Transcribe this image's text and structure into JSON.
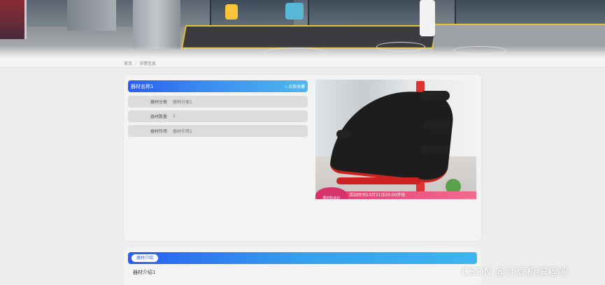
{
  "breadcrumb": {
    "home": "首页",
    "separator": "/",
    "current": "详情信息"
  },
  "equipment": {
    "name": "器材名称1",
    "like_label": "点我收藏",
    "fields": [
      {
        "label": "器材分类",
        "value": "器材分类1"
      },
      {
        "label": "器材数量",
        "value": "1"
      },
      {
        "label": "器材作用",
        "value": "器材作用1"
      }
    ],
    "photo_promo": "活动时间10月31日20:00开抢",
    "photo_badge": "限时秒杀价"
  },
  "intro": {
    "tab_label": "器材介绍",
    "content": "器材介绍1"
  },
  "watermark": "CSDN @计算机编程吧",
  "colors": {
    "accent_start": "#2b5ef0",
    "accent_end": "#4fb8ee",
    "background": "#ededed"
  }
}
